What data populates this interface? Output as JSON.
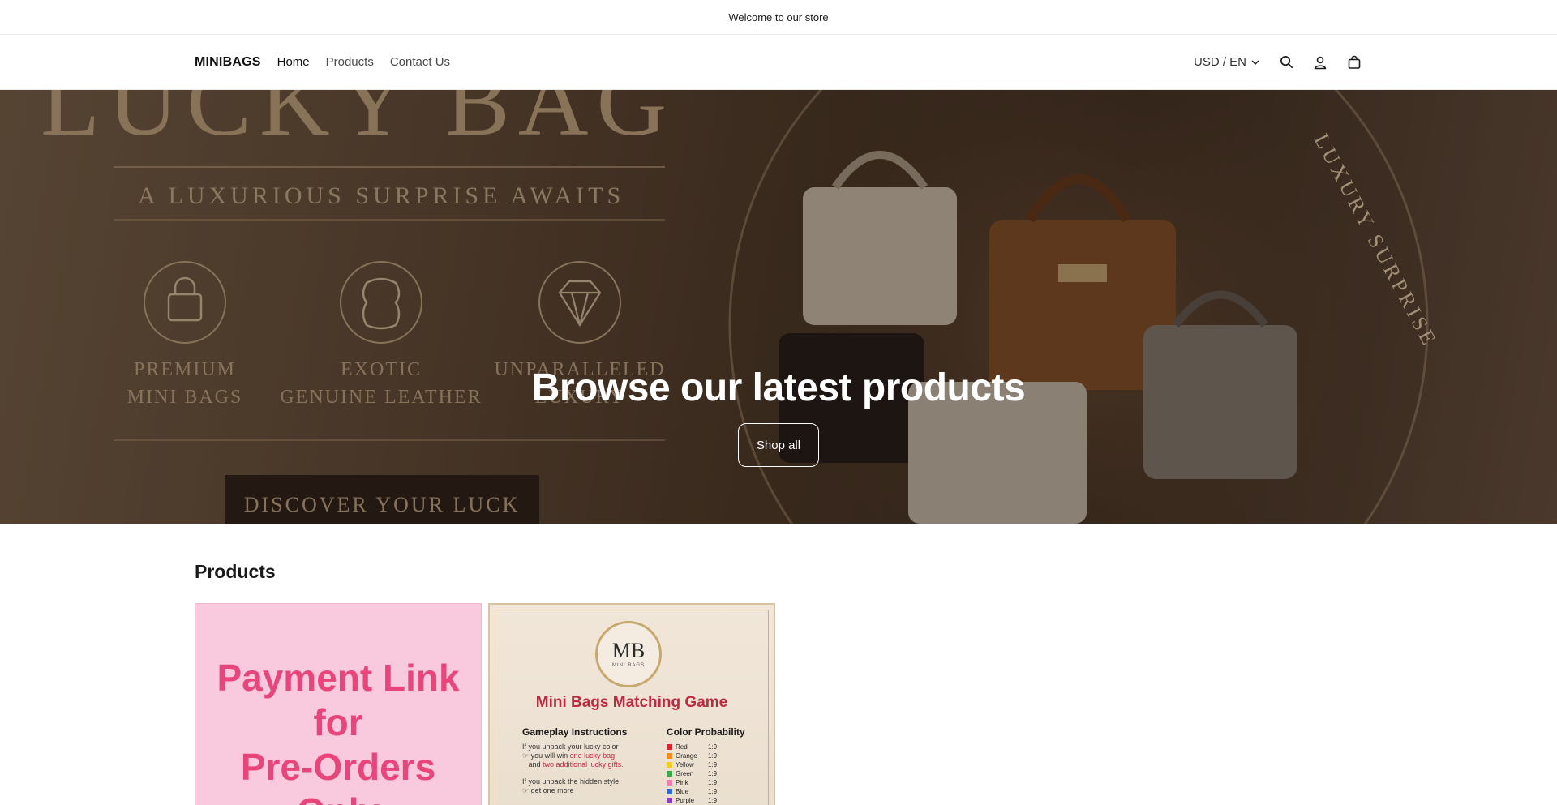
{
  "announcement": {
    "text": "Welcome to our store"
  },
  "header": {
    "logo": "MINIBAGS",
    "nav": [
      {
        "label": "Home"
      },
      {
        "label": "Products"
      },
      {
        "label": "Contact Us"
      }
    ],
    "locale": "USD / EN",
    "icons": [
      "search-icon",
      "account-icon",
      "cart-icon"
    ]
  },
  "hero": {
    "banner_text": {
      "headline": "LUCKY BAG",
      "tagline": "A LUXURIOUS SURPRISE AWAITS",
      "features": [
        {
          "line1": "PREMIUM",
          "line2": "MINI BAGS"
        },
        {
          "line1": "EXOTIC",
          "line2": "GENUINE LEATHER"
        },
        {
          "line1": "UNPARALLELED",
          "line2": "LUXURY"
        }
      ],
      "cta": "DISCOVER YOUR LUCK",
      "ribbon": "LUXURY SURPRISE"
    },
    "title": "Browse our latest products",
    "button": "Shop all"
  },
  "products": {
    "title": "Products",
    "items": [
      {
        "image_text": [
          "Payment Link",
          "for",
          "Pre-Orders",
          "Only"
        ],
        "colors": {
          "bg": "#f9c9de",
          "text": "#e8457a"
        }
      },
      {
        "badge": {
          "monogram": "MB",
          "sub": "MINI BAGS"
        },
        "image_title": "Mini Bags Matching Game",
        "instructions_title": "Gameplay Instructions",
        "instructions": [
          {
            "text": "If you unpack your lucky color",
            "detail_a": "you will win ",
            "highlight_a": "one lucky bag",
            "detail_b": "and ",
            "highlight_b": "two additional lucky gifts."
          },
          {
            "text": "If you unpack the hidden style",
            "detail_a": "get one more"
          }
        ],
        "probability_title": "Color Probability",
        "probabilities": [
          {
            "name": "Red",
            "ratio": "1:9",
            "color": "#d8262e"
          },
          {
            "name": "Orange",
            "ratio": "1:9",
            "color": "#f08a1c"
          },
          {
            "name": "Yellow",
            "ratio": "1:9",
            "color": "#f2cf1d"
          },
          {
            "name": "Green",
            "ratio": "1:9",
            "color": "#3aa84a"
          },
          {
            "name": "Pink",
            "ratio": "1:9",
            "color": "#ef7fb0"
          },
          {
            "name": "Blue",
            "ratio": "1:9",
            "color": "#2f6ad6"
          },
          {
            "name": "Purple",
            "ratio": "1:9",
            "color": "#8a3fc2"
          }
        ]
      }
    ]
  }
}
